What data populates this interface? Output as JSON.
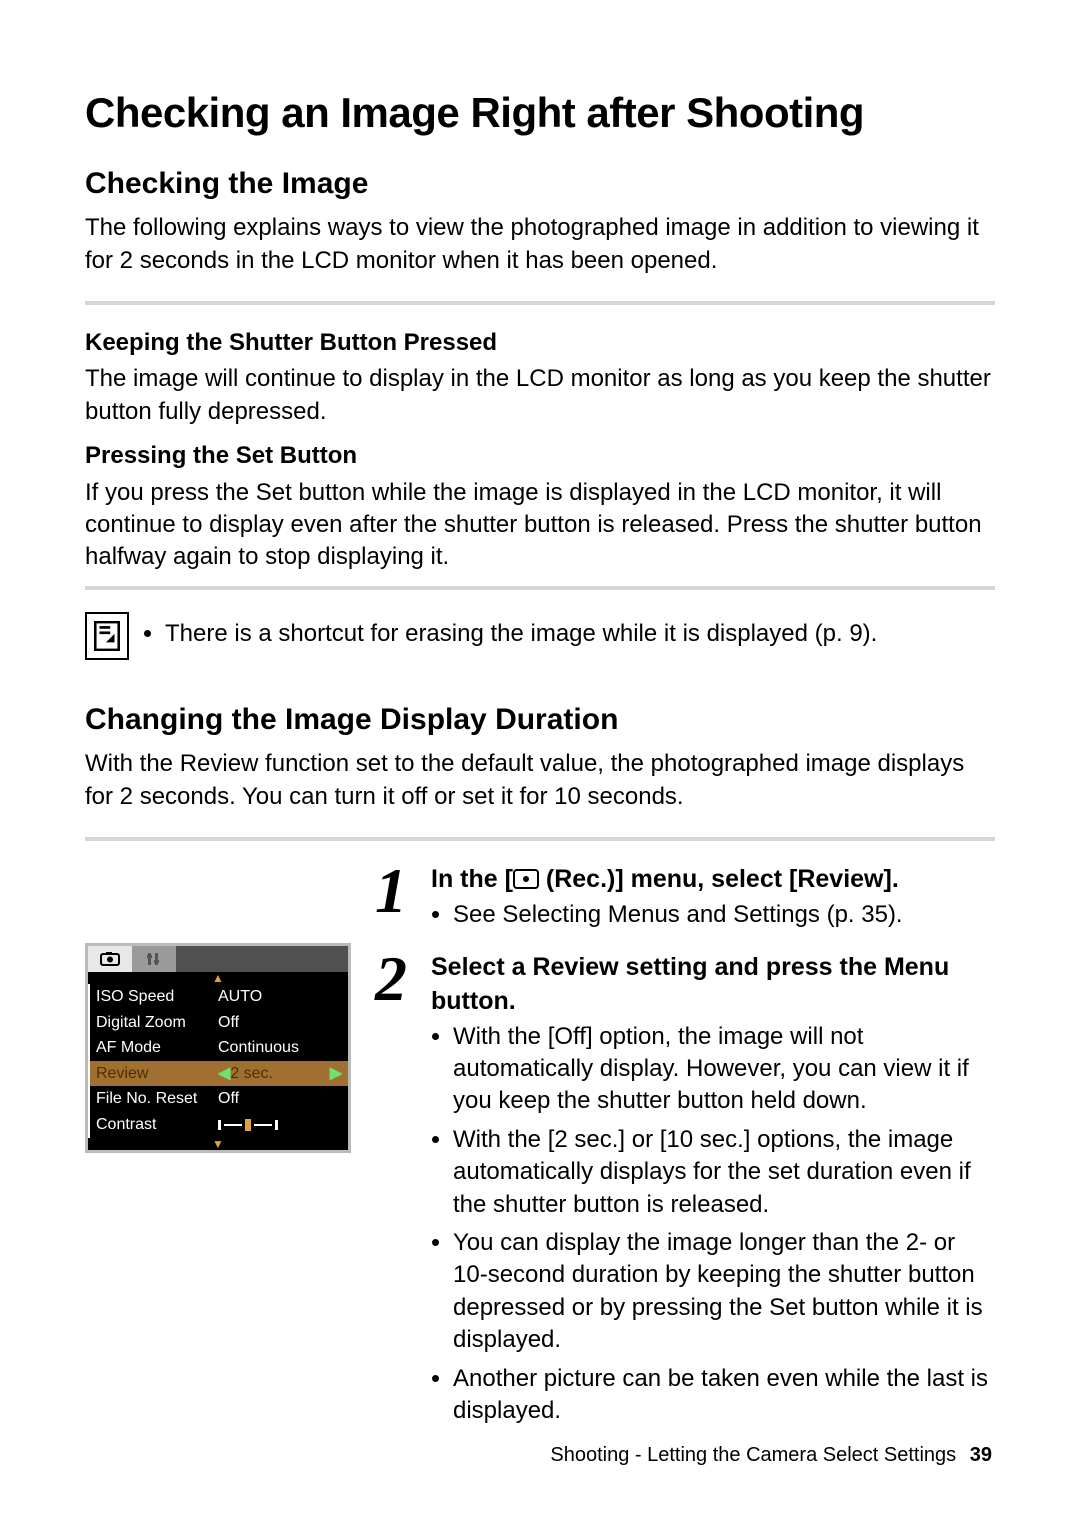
{
  "title": "Checking an Image Right after Shooting",
  "section1": {
    "heading": "Checking the Image",
    "intro": "The following explains ways to view the photographed image in addition to viewing it for 2 seconds in the LCD monitor when it has been opened.",
    "sub1_title": "Keeping the Shutter Button Pressed",
    "sub1_body": "The image will continue to display in the LCD monitor as long as you keep the shutter button fully depressed.",
    "sub2_title": "Pressing the Set Button",
    "sub2_body": "If you press the Set button while the image is displayed in the LCD monitor, it will continue to display even after the shutter button is released. Press the shutter button halfway again to stop displaying it.",
    "tip": "There is a shortcut for erasing the image while it is displayed (p. 9)."
  },
  "section2": {
    "heading": "Changing the Image Display Duration",
    "intro": "With the Review function set to the default value, the photographed image displays for 2 seconds. You can turn it off or set it for 10 seconds."
  },
  "steps": {
    "s1": {
      "num": "1",
      "title_pre": "In the [",
      "title_post": " (Rec.)] menu, select [Review].",
      "b1": "See Selecting Menus and Settings (p. 35)."
    },
    "s2": {
      "num": "2",
      "title": "Select a Review setting and press the Menu button.",
      "b1": "With the [Off] option, the image will not automatically display. However, you can view it if you keep the shutter button held down.",
      "b2": "With the [2 sec.] or [10 sec.] options, the image automatically displays for the set duration even if the shutter button is released.",
      "b3": "You can display the image longer than the 2- or 10-second duration by keeping the shutter button depressed or by pressing the Set button while it is displayed.",
      "b4": "Another picture can be taken even while the last is displayed."
    }
  },
  "menu": {
    "rows": {
      "r1": {
        "k": "ISO Speed",
        "v": "AUTO"
      },
      "r2": {
        "k": "Digital Zoom",
        "v": "Off"
      },
      "r3": {
        "k": "AF Mode",
        "v": "Continuous"
      },
      "r4": {
        "k": "Review",
        "v": "2 sec."
      },
      "r5": {
        "k": "File No. Reset",
        "v": "Off"
      },
      "r6": {
        "k": "Contrast",
        "v": ""
      }
    }
  },
  "footer": {
    "text": "Shooting - Letting the Camera Select Settings",
    "page": "39"
  }
}
